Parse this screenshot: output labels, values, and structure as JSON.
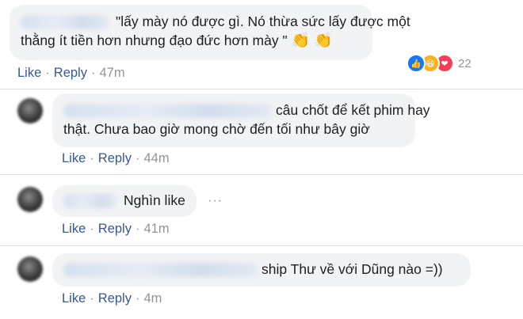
{
  "comments": [
    {
      "text_line1": "\"lấy mày nó được gì. Nó thừa sức lấy được một",
      "text_line2": "thằng ít tiền hơn nhưng đạo đức hơn mày \"",
      "emojis": [
        "👏",
        "👏"
      ],
      "like_label": "Like",
      "reply_label": "Reply",
      "time": "47m",
      "reaction_count": "22",
      "reactions": [
        "like-icon",
        "haha-icon",
        "love-icon"
      ]
    },
    {
      "text_line1": "câu chốt để kết phim hay",
      "text_line2": "thật. Chưa bao giờ mong chờ đến tối như bây giờ",
      "like_label": "Like",
      "reply_label": "Reply",
      "time": "44m"
    },
    {
      "text": "Nghìn like",
      "like_label": "Like",
      "reply_label": "Reply",
      "time": "41m",
      "more_icon": "more-options-icon"
    },
    {
      "text": "ship Thư về với Dũng nào =))",
      "like_label": "Like",
      "reply_label": "Reply",
      "time": "4m"
    }
  ],
  "colors": {
    "link": "#385898",
    "meta": "#90949c",
    "bubble": "#f2f3f5",
    "like_reaction": "#1877f2",
    "haha_reaction": "#f7b125",
    "love_reaction": "#f33e58"
  }
}
